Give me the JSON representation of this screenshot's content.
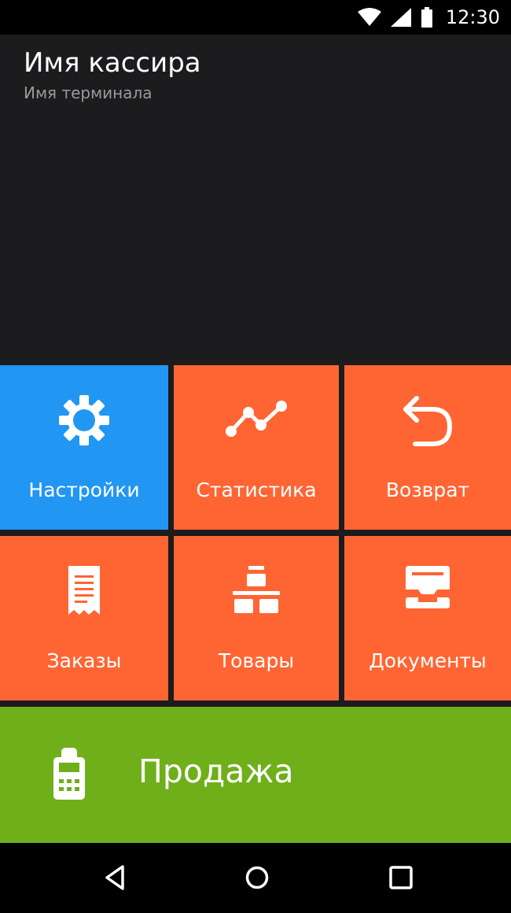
{
  "status_bar": {
    "time": "12:30",
    "icons": [
      "wifi-icon",
      "signal-icon",
      "battery-icon"
    ]
  },
  "header": {
    "cashier_name": "Имя кассира",
    "terminal_name": "Имя терминала"
  },
  "tiles": [
    {
      "label": "Настройки",
      "icon": "gear-icon",
      "color": "#2196f3"
    },
    {
      "label": "Статистика",
      "icon": "chart-line-icon",
      "color": "#ff6533"
    },
    {
      "label": "Возврат",
      "icon": "return-arrow-icon",
      "color": "#ff6533"
    },
    {
      "label": "Заказы",
      "icon": "receipt-icon",
      "color": "#ff6533"
    },
    {
      "label": "Товары",
      "icon": "boxes-icon",
      "color": "#ff6533"
    },
    {
      "label": "Документы",
      "icon": "inbox-tray-icon",
      "color": "#ff6533"
    }
  ],
  "sale": {
    "label": "Продажа",
    "icon": "payment-terminal-icon",
    "color": "#6faf1a"
  },
  "nav_bar": {
    "icons": [
      "back-icon",
      "home-icon",
      "recents-icon"
    ]
  }
}
